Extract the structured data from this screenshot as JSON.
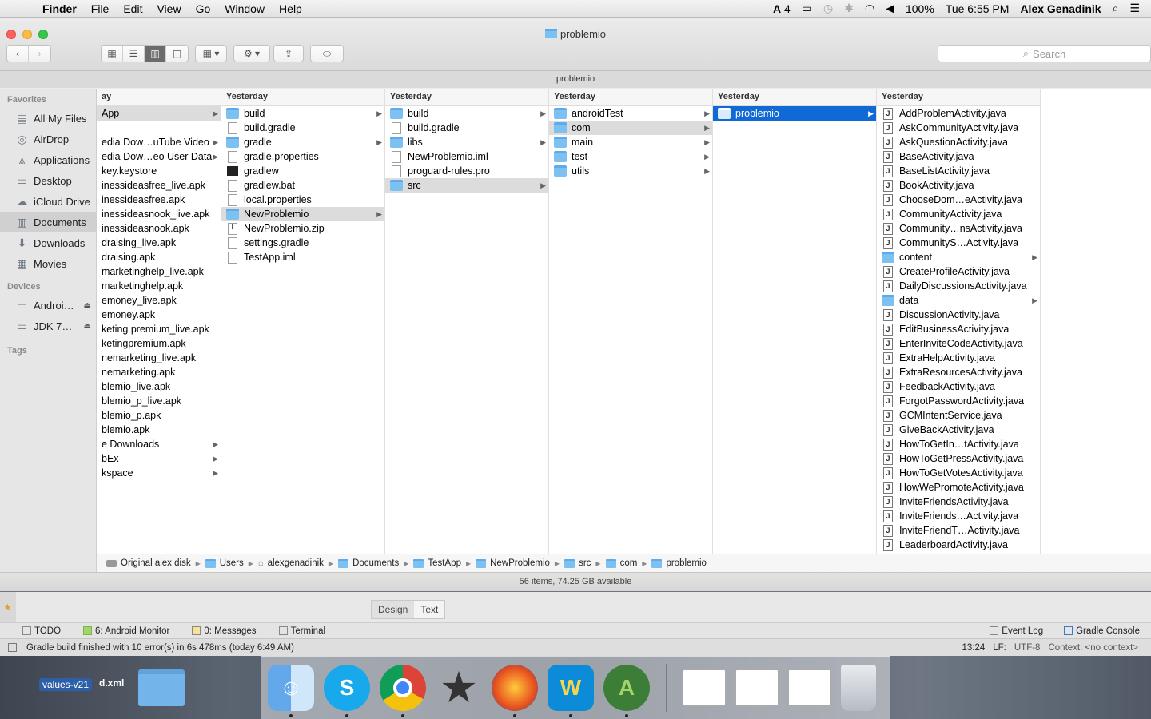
{
  "menubar": {
    "app": "Finder",
    "menus": [
      "File",
      "Edit",
      "View",
      "Go",
      "Window",
      "Help"
    ],
    "status": {
      "adobe": "4",
      "battery": "100%",
      "clock": "Tue 6:55 PM",
      "user": "Alex Genadinik"
    }
  },
  "window": {
    "title": "problemio",
    "path_title": "problemio",
    "search_placeholder": "Search"
  },
  "sidebar": {
    "favorites_header": "Favorites",
    "favorites": [
      {
        "label": "All My Files",
        "icon": "all-files-icon"
      },
      {
        "label": "AirDrop",
        "icon": "airdrop-icon"
      },
      {
        "label": "Applications",
        "icon": "applications-icon"
      },
      {
        "label": "Desktop",
        "icon": "desktop-icon"
      },
      {
        "label": "iCloud Drive",
        "icon": "cloud-icon"
      },
      {
        "label": "Documents",
        "icon": "documents-icon"
      },
      {
        "label": "Downloads",
        "icon": "downloads-icon"
      },
      {
        "label": "Movies",
        "icon": "movies-icon"
      }
    ],
    "devices_header": "Devices",
    "devices": [
      {
        "label": "Androi…"
      },
      {
        "label": "JDK 7…"
      }
    ],
    "tags_header": "Tags"
  },
  "columns": [
    {
      "header": "ay",
      "rows": [
        {
          "label": "App",
          "type": "none",
          "arrow": true,
          "sel": "grey"
        },
        {
          "label": "",
          "type": "none"
        },
        {
          "label": "edia Dow…uTube Video",
          "type": "none",
          "arrow": true
        },
        {
          "label": "edia Dow…eo User Data",
          "type": "none",
          "arrow": true
        },
        {
          "label": "key.keystore",
          "type": "none"
        },
        {
          "label": "inessideasfree_live.apk",
          "type": "none"
        },
        {
          "label": "inessideasfree.apk",
          "type": "none"
        },
        {
          "label": "inessideasnook_live.apk",
          "type": "none"
        },
        {
          "label": "inessideasnook.apk",
          "type": "none"
        },
        {
          "label": "draising_live.apk",
          "type": "none"
        },
        {
          "label": "draising.apk",
          "type": "none"
        },
        {
          "label": "marketinghelp_live.apk",
          "type": "none"
        },
        {
          "label": "marketinghelp.apk",
          "type": "none"
        },
        {
          "label": "emoney_live.apk",
          "type": "none"
        },
        {
          "label": "emoney.apk",
          "type": "none"
        },
        {
          "label": "keting premium_live.apk",
          "type": "none"
        },
        {
          "label": "ketingpremium.apk",
          "type": "none"
        },
        {
          "label": "nemarketing_live.apk",
          "type": "none"
        },
        {
          "label": "nemarketing.apk",
          "type": "none"
        },
        {
          "label": "blemio_live.apk",
          "type": "none"
        },
        {
          "label": "blemio_p_live.apk",
          "type": "none"
        },
        {
          "label": "blemio_p.apk",
          "type": "none"
        },
        {
          "label": "blemio.apk",
          "type": "none"
        },
        {
          "label": "e Downloads",
          "type": "none",
          "arrow": true
        },
        {
          "label": "bEx",
          "type": "none",
          "arrow": true
        },
        {
          "label": "kspace",
          "type": "none",
          "arrow": true
        }
      ]
    },
    {
      "header": "Yesterday",
      "rows": [
        {
          "label": "build",
          "type": "folder",
          "arrow": true
        },
        {
          "label": "build.gradle",
          "type": "doc"
        },
        {
          "label": "gradle",
          "type": "folder",
          "arrow": true
        },
        {
          "label": "gradle.properties",
          "type": "doc"
        },
        {
          "label": "gradlew",
          "type": "exec"
        },
        {
          "label": "gradlew.bat",
          "type": "doc"
        },
        {
          "label": "local.properties",
          "type": "doc"
        },
        {
          "label": "NewProblemio",
          "type": "folder",
          "arrow": true,
          "sel": "grey"
        },
        {
          "label": "NewProblemio.zip",
          "type": "zip"
        },
        {
          "label": "settings.gradle",
          "type": "doc"
        },
        {
          "label": "TestApp.iml",
          "type": "doc"
        }
      ]
    },
    {
      "header": "Yesterday",
      "rows": [
        {
          "label": "build",
          "type": "folder",
          "arrow": true
        },
        {
          "label": "build.gradle",
          "type": "doc"
        },
        {
          "label": "libs",
          "type": "folder",
          "arrow": true
        },
        {
          "label": "NewProblemio.iml",
          "type": "doc"
        },
        {
          "label": "proguard-rules.pro",
          "type": "doc"
        },
        {
          "label": "src",
          "type": "folder",
          "arrow": true,
          "sel": "grey"
        }
      ]
    },
    {
      "header": "Yesterday",
      "rows": [
        {
          "label": "androidTest",
          "type": "folder",
          "arrow": true
        },
        {
          "label": "com",
          "type": "folder",
          "arrow": true,
          "sel": "grey"
        },
        {
          "label": "main",
          "type": "folder",
          "arrow": true
        },
        {
          "label": "test",
          "type": "folder",
          "arrow": true
        },
        {
          "label": "utils",
          "type": "folder",
          "arrow": true
        }
      ]
    },
    {
      "header": "Yesterday",
      "rows": [
        {
          "label": "problemio",
          "type": "folder",
          "arrow": true,
          "sel": "blue"
        }
      ]
    },
    {
      "header": "Yesterday",
      "rows": [
        {
          "label": "AddProblemActivity.java",
          "type": "java"
        },
        {
          "label": "AskCommunityActivity.java",
          "type": "java"
        },
        {
          "label": "AskQuestionActivity.java",
          "type": "java"
        },
        {
          "label": "BaseActivity.java",
          "type": "java"
        },
        {
          "label": "BaseListActivity.java",
          "type": "java"
        },
        {
          "label": "BookActivity.java",
          "type": "java"
        },
        {
          "label": "ChooseDom…eActivity.java",
          "type": "java"
        },
        {
          "label": "CommunityActivity.java",
          "type": "java"
        },
        {
          "label": "Community…nsActivity.java",
          "type": "java"
        },
        {
          "label": "CommunityS…Activity.java",
          "type": "java"
        },
        {
          "label": "content",
          "type": "folder",
          "arrow": true
        },
        {
          "label": "CreateProfileActivity.java",
          "type": "java"
        },
        {
          "label": "DailyDiscussionsActivity.java",
          "type": "java"
        },
        {
          "label": "data",
          "type": "folder",
          "arrow": true
        },
        {
          "label": "DiscussionActivity.java",
          "type": "java"
        },
        {
          "label": "EditBusinessActivity.java",
          "type": "java"
        },
        {
          "label": "EnterInviteCodeActivity.java",
          "type": "java"
        },
        {
          "label": "ExtraHelpActivity.java",
          "type": "java"
        },
        {
          "label": "ExtraResourcesActivity.java",
          "type": "java"
        },
        {
          "label": "FeedbackActivity.java",
          "type": "java"
        },
        {
          "label": "ForgotPasswordActivity.java",
          "type": "java"
        },
        {
          "label": "GCMIntentService.java",
          "type": "java"
        },
        {
          "label": "GiveBackActivity.java",
          "type": "java"
        },
        {
          "label": "HowToGetIn…tActivity.java",
          "type": "java"
        },
        {
          "label": "HowToGetPressActivity.java",
          "type": "java"
        },
        {
          "label": "HowToGetVotesActivity.java",
          "type": "java"
        },
        {
          "label": "HowWePromoteActivity.java",
          "type": "java"
        },
        {
          "label": "InviteFriendsActivity.java",
          "type": "java"
        },
        {
          "label": "InviteFriends…Activity.java",
          "type": "java"
        },
        {
          "label": "InviteFriendT…Activity.java",
          "type": "java"
        },
        {
          "label": "LeaderboardActivity.java",
          "type": "java"
        }
      ]
    }
  ],
  "breadcrumb": [
    {
      "label": "Original alex disk",
      "icon": "disk"
    },
    {
      "label": "Users",
      "icon": "folder"
    },
    {
      "label": "alexgenadinik",
      "icon": "home"
    },
    {
      "label": "Documents",
      "icon": "folder"
    },
    {
      "label": "TestApp",
      "icon": "folder"
    },
    {
      "label": "NewProblemio",
      "icon": "folder"
    },
    {
      "label": "src",
      "icon": "folder"
    },
    {
      "label": "com",
      "icon": "folder"
    },
    {
      "label": "problemio",
      "icon": "folder"
    }
  ],
  "status": "56 items, 74.25 GB available",
  "ide": {
    "tabs": [
      "Design",
      "Text"
    ],
    "tool_windows": [
      "TODO",
      "6: Android Monitor",
      "0: Messages",
      "Terminal"
    ],
    "right_tools": [
      "Event Log",
      "Gradle Console"
    ],
    "message": "Gradle build finished with 10 error(s) in 6s 478ms (today 6:49 AM)",
    "position": "13:24",
    "line_sep": "LF:",
    "encoding": "UTF-8",
    "context": "Context: <no context>"
  },
  "desktop": {
    "label": "values-v21",
    "xml": "d.xml"
  },
  "dock": [
    "finder-icon",
    "skype-icon",
    "chrome-icon",
    "imovie-icon",
    "firefox-icon",
    "webex-icon",
    "android-studio-icon"
  ]
}
